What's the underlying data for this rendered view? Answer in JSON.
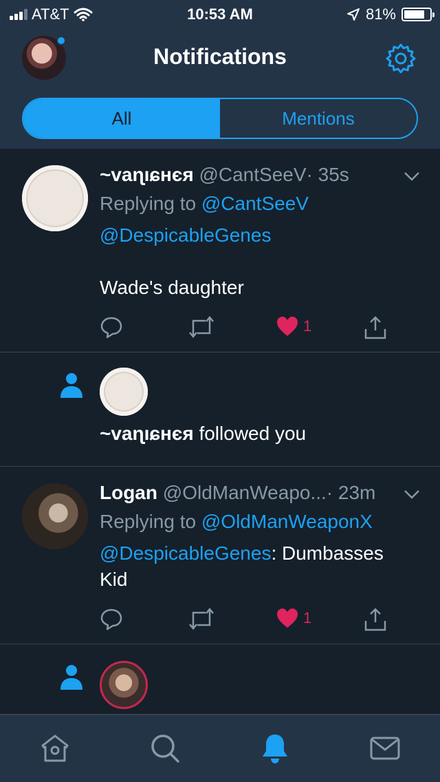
{
  "status_bar": {
    "carrier": "AT&T",
    "time": "10:53 AM",
    "battery": "81%",
    "battery_level": 0.81
  },
  "header": {
    "title": "Notifications"
  },
  "tabs": [
    {
      "label": "All",
      "active": true
    },
    {
      "label": "Mentions",
      "active": false
    }
  ],
  "notifications": [
    {
      "type": "reply",
      "display_name": "~vaɳıɕнєя",
      "handle": "@CantSeeV",
      "time": "· 35s",
      "replying_to_label": "Replying to",
      "replying_to": "@CantSeeV",
      "mention": "@DespicableGenes",
      "text": "Wade's daughter",
      "likes": "1"
    },
    {
      "type": "follow",
      "display_name": "~vaɳıɕнєя",
      "text": "followed you"
    },
    {
      "type": "reply",
      "display_name": "Logan",
      "handle": "@OldManWeapo...",
      "time": "· 23m",
      "replying_to_label": "Replying to",
      "replying_to": "@OldManWeaponX",
      "mention": "@DespicableGenes",
      "text_suffix": ": Dumbasses",
      "text_line2": "Kid",
      "likes": "1"
    },
    {
      "type": "follow"
    }
  ],
  "tabbar": [
    {
      "icon": "home-icon",
      "active": false
    },
    {
      "icon": "search-icon",
      "active": false
    },
    {
      "icon": "bell-icon",
      "active": true
    },
    {
      "icon": "mail-icon",
      "active": false
    }
  ],
  "colors": {
    "accent": "#1da1f2",
    "background": "#15202b",
    "header": "#243447",
    "like": "#e0245e",
    "muted": "#8899a6"
  }
}
